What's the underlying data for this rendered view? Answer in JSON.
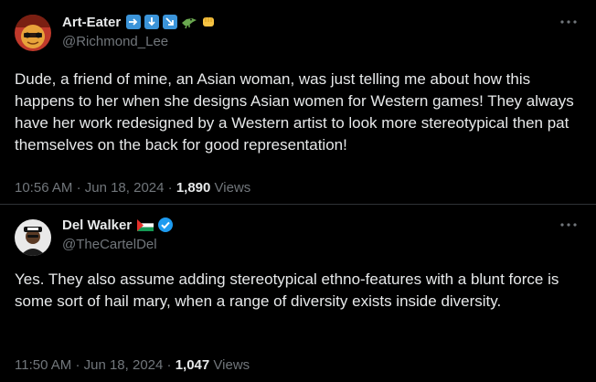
{
  "posts": [
    {
      "display_name": "Art-Eater",
      "name_emojis": [
        "right-arrow-emoji",
        "down-arrow-emoji",
        "down-right-arrow-emoji",
        "crocodile-emoji",
        "fist-emoji"
      ],
      "handle": "@Richmond_Lee",
      "text": "Dude, a friend of mine, an Asian woman, was just telling me about how this happens to her when she designs Asian women for Western games! They always have her work redesigned by a Western artist to look more stereotypical then pat themselves on the back for good representation!",
      "time": "10:56 AM",
      "sep1": "·",
      "date": "Jun 18, 2024",
      "sep2": "·",
      "views_count": "1,890",
      "views_label": "Views"
    },
    {
      "display_name": "Del Walker",
      "name_emojis": [
        "palestine-flag-emoji",
        "verified-badge-icon"
      ],
      "handle": "@TheCartelDel",
      "text": "Yes. They also assume adding stereotypical ethno-features with a blunt force is some sort of hail mary, when a range of diversity exists inside diversity.",
      "time": "11:50 AM",
      "sep1": "·",
      "date": "Jun 18, 2024",
      "sep2": "·",
      "views_count": "1,047",
      "views_label": "Views"
    }
  ],
  "colors": {
    "background": "#000000",
    "text_primary": "#e7e9ea",
    "text_secondary": "#71767b",
    "divider": "#2f3336",
    "verified": "#1d9bf0"
  }
}
